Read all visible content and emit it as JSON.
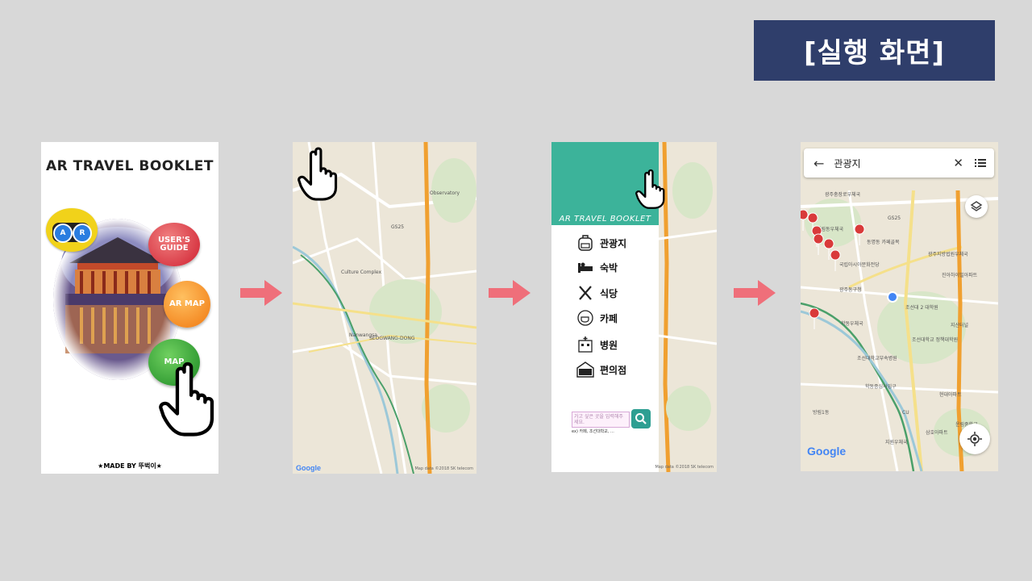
{
  "banner": {
    "title": "[실행 화면]"
  },
  "screen1": {
    "title": "AR TRAVEL BOOKLET",
    "ar_badge": [
      "A",
      "R"
    ],
    "buttons": {
      "users_guide": "USER'S GUIDE",
      "ar_map": "AR MAP",
      "map": "MAP"
    },
    "footer": "★MADE BY 뚜벅이★"
  },
  "screen2": {
    "map_labels": [
      "Observatory",
      "Culture Complex",
      "SEOGWANG-DONG",
      "GS25",
      "Nanwangsa"
    ],
    "credit": "Map data ©2018 SK telecom"
  },
  "screen3": {
    "brand": "AR TRAVEL BOOKLET",
    "menu": [
      "관광지",
      "숙박",
      "식당",
      "카페",
      "병원",
      "편의점"
    ],
    "menu_icons": [
      "backpack-icon",
      "bed-icon",
      "cutlery-icon",
      "coffee-icon",
      "hospital-icon",
      "ministop-icon"
    ],
    "search_placeholder": "가고 싶은 곳을 입력해주세요.",
    "search_hint": "ex) 카페, 조선대학교, ...",
    "credit": "Map data ©2018 SK telecom"
  },
  "screen4": {
    "query": "관광지",
    "map_labels": [
      "광주충장로우체국",
      "계림동우체국",
      "GS25",
      "동명동 카페골목",
      "국립아시아문화전당",
      "광주지방법원우체국",
      "진아하이빌아파트",
      "광주동구청",
      "조선대 2 대학원",
      "학동우체국",
      "조선대학교 정책대학원",
      "지산터널",
      "조선대학교부속병원",
      "학동증심사입구",
      "현대아파트",
      "CU",
      "운림중학교",
      "지원우체국",
      "삼호아파트",
      "방림1동"
    ],
    "google": "Google"
  },
  "colors": {
    "banner": "#2f3e6b",
    "accent_teal": "#3cb39a",
    "arrow": "#ef6f7a",
    "pin": "#d93a3a"
  }
}
